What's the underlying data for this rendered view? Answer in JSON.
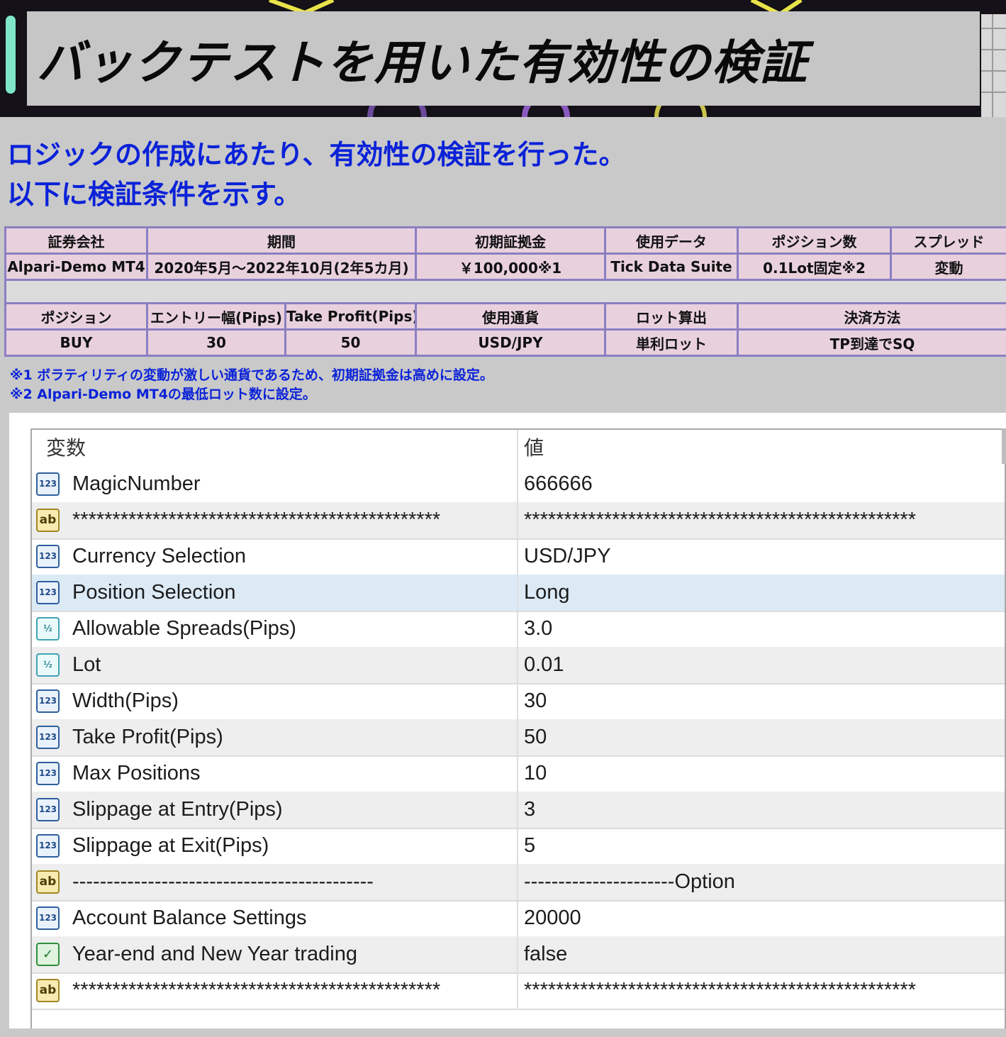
{
  "header": {
    "title": "バックテストを用いた有効性の検証"
  },
  "intro": {
    "line1": "ロジックの作成にあたり、有効性の検証を行った。",
    "line2": "以下に検証条件を示す。"
  },
  "conditions": {
    "row1_headers": [
      "証券会社",
      "期間",
      "初期証拠金",
      "使用データ",
      "ポジション数",
      "スプレッド"
    ],
    "row1_values": [
      "Alpari-Demo MT4",
      "2020年5月～2022年10月(2年5カ月)",
      "￥100,000※1",
      "Tick Data Suite",
      "0.1Lot固定※2",
      "変動"
    ],
    "row2_headers": [
      "ポジション",
      "エントリー幅(Pips)",
      "Take Profit(Pips)",
      "使用通貨",
      "ロット算出",
      "決済方法"
    ],
    "row2_values": [
      "BUY",
      "30",
      "50",
      "USD/JPY",
      "単利ロット",
      "TP到達でSQ"
    ]
  },
  "notes": {
    "note1": "※1 ボラティリティの変動が激しい通貨であるため、初期証拠金は高めに設定。",
    "note2": "※2 Alpari-Demo MT4の最低ロット数に設定。"
  },
  "params": {
    "header_name": "変数",
    "header_value": "値",
    "rows": [
      {
        "type": "int",
        "icon_label": "123",
        "name": "MagicNumber",
        "value": "666666"
      },
      {
        "type": "str",
        "icon_label": "ab",
        "name": "**********************************************",
        "value": "*************************************************"
      },
      {
        "type": "int",
        "icon_label": "123",
        "name": "Currency Selection",
        "value": "USD/JPY"
      },
      {
        "type": "int",
        "icon_label": "123",
        "name": "Position Selection",
        "value": "Long",
        "selected": true
      },
      {
        "type": "dbl",
        "icon_label": "½",
        "name": "Allowable Spreads(Pips)",
        "value": "3.0"
      },
      {
        "type": "dbl",
        "icon_label": "½",
        "name": "Lot",
        "value": "0.01"
      },
      {
        "type": "int",
        "icon_label": "123",
        "name": "Width(Pips)",
        "value": "30"
      },
      {
        "type": "int",
        "icon_label": "123",
        "name": "Take Profit(Pips)",
        "value": "50"
      },
      {
        "type": "int",
        "icon_label": "123",
        "name": "Max Positions",
        "value": "10"
      },
      {
        "type": "int",
        "icon_label": "123",
        "name": "Slippage at Entry(Pips)",
        "value": "3"
      },
      {
        "type": "int",
        "icon_label": "123",
        "name": "Slippage at Exit(Pips)",
        "value": "5"
      },
      {
        "type": "str",
        "icon_label": "ab",
        "name": "--------------------------------------------",
        "value": "----------------------Option"
      },
      {
        "type": "int",
        "icon_label": "123",
        "name": "Account Balance Settings",
        "value": "20000"
      },
      {
        "type": "bool",
        "icon_label": "✓",
        "name": "Year-end and New Year trading",
        "value": "false"
      },
      {
        "type": "str",
        "icon_label": "ab",
        "name": "**********************************************",
        "value": "*************************************************"
      }
    ]
  }
}
